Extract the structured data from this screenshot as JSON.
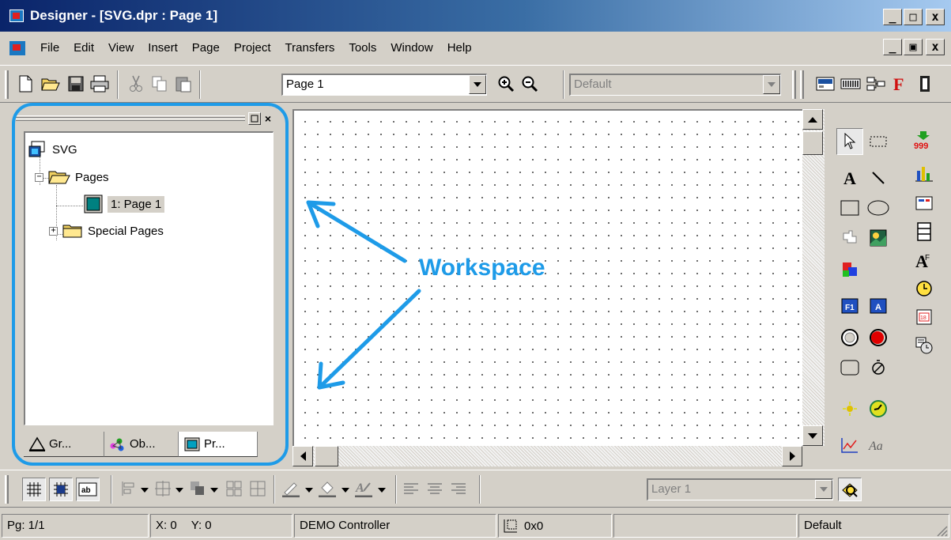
{
  "window": {
    "title": "Designer - [SVG.dpr : Page 1]",
    "caption_buttons": {
      "minimize": "_",
      "maximize": "□",
      "close": "x"
    },
    "doc_buttons": {
      "minimize": "_",
      "restore": "▣",
      "close": "x"
    }
  },
  "menu": {
    "items": [
      "File",
      "Edit",
      "View",
      "Insert",
      "Page",
      "Project",
      "Transfers",
      "Tools",
      "Window",
      "Help"
    ]
  },
  "toolbar": {
    "page_combo_value": "Page 1",
    "style_combo_value": "Default"
  },
  "tree": {
    "root": "SVG",
    "pages_folder": "Pages",
    "page_item": "1: Page 1",
    "special_pages": "Special Pages"
  },
  "panel_tabs": [
    {
      "label": "Gr..."
    },
    {
      "label": "Ob..."
    },
    {
      "label": "Pr..."
    }
  ],
  "annotation": {
    "label": "Workspace",
    "color": "#1e9be8"
  },
  "bottom_toolbar": {
    "layer_combo_value": "Layer 1"
  },
  "status": {
    "page": "Pg: 1/1",
    "x": "X: 0",
    "y": "Y: 0",
    "controller": "DEMO Controller",
    "size": "0x0",
    "empty": "",
    "style": "Default"
  }
}
